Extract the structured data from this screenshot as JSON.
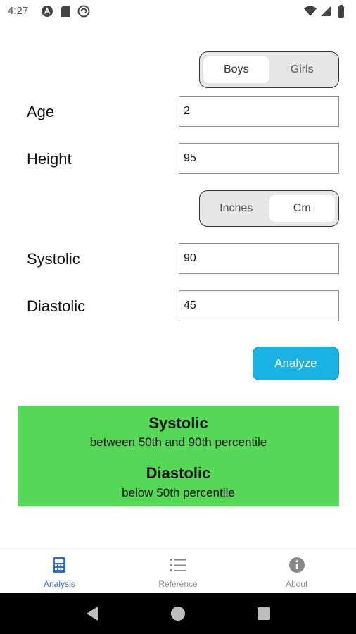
{
  "status_bar": {
    "time": "4:27",
    "left_icons": [
      "a-badge-icon",
      "sd-card-icon",
      "sync-icon"
    ],
    "right_icons": [
      "wifi-icon",
      "signal-icon",
      "battery-icon"
    ]
  },
  "gender": {
    "options": [
      "Boys",
      "Girls"
    ],
    "selected": "Boys"
  },
  "form": {
    "age": {
      "label": "Age",
      "value": "2"
    },
    "height": {
      "label": "Height",
      "value": "95"
    },
    "systolic": {
      "label": "Systolic",
      "value": "90"
    },
    "diastolic": {
      "label": "Diastolic",
      "value": "45"
    }
  },
  "units": {
    "options": [
      "Inches",
      "Cm"
    ],
    "selected": "Cm"
  },
  "analyze_label": "Analyze",
  "result": {
    "systolic_title": "Systolic",
    "systolic_text": "between 50th and 90th percentile",
    "diastolic_title": "Diastolic",
    "diastolic_text": "below 50th percentile",
    "background": "#55d855"
  },
  "tabs": [
    {
      "label": "Analysis",
      "icon": "calculator-icon",
      "active": true
    },
    {
      "label": "Reference",
      "icon": "list-icon",
      "active": false
    },
    {
      "label": "About",
      "icon": "info-icon",
      "active": false
    }
  ],
  "colors": {
    "accent_button": "#1ab2e3",
    "active_tab": "#2e6fd1",
    "result_bg": "#55d855"
  }
}
